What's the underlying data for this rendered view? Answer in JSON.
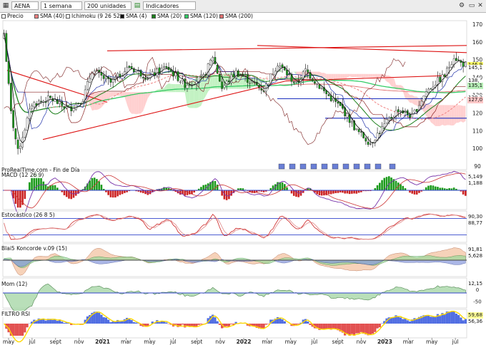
{
  "toolbar": {
    "symbol": "AENA",
    "interval": "1 semana",
    "bars": "200 unidades",
    "indicators": "Indicadores"
  },
  "legend": [
    {
      "label": "Precio",
      "color": "#ffffff"
    },
    {
      "label": "SMA (40)",
      "color": "#f08080"
    },
    {
      "label": "Ichimoku (9 26 52)",
      "color": "#ffffff"
    },
    {
      "label": "SMA (4)",
      "color": "#111111"
    },
    {
      "label": "SMA (20)",
      "color": "#1a7f1a"
    },
    {
      "label": "SMA (120)",
      "color": "#33cc66"
    },
    {
      "label": "SMA (200)",
      "color": "#e07070"
    }
  ],
  "source_label": "ProRealTime.com - Fin de Día",
  "chart_data": {
    "type": "candlestick",
    "x_ticks": [
      "may",
      "jul",
      "sept",
      "nov",
      "2021",
      "mar",
      "may",
      "jul",
      "sept",
      "nov",
      "2022",
      "mar",
      "may",
      "jul",
      "sept",
      "nov",
      "2023",
      "mar",
      "may",
      "jul"
    ],
    "y_ticks": [
      90,
      100,
      110,
      120,
      130,
      140,
      150,
      160,
      170
    ],
    "ylim": [
      88,
      172
    ],
    "grid": false,
    "price_anchors": [
      [
        0,
        165
      ],
      [
        3,
        120
      ],
      [
        6,
        98
      ],
      [
        12,
        125
      ],
      [
        20,
        128
      ],
      [
        28,
        122
      ],
      [
        34,
        128
      ],
      [
        38,
        144
      ],
      [
        46,
        137
      ],
      [
        54,
        146
      ],
      [
        62,
        140
      ],
      [
        70,
        146
      ],
      [
        78,
        136
      ],
      [
        86,
        140
      ],
      [
        90,
        152
      ],
      [
        94,
        134
      ],
      [
        100,
        143
      ],
      [
        106,
        138
      ],
      [
        112,
        133
      ],
      [
        118,
        148
      ],
      [
        126,
        136
      ],
      [
        130,
        144
      ],
      [
        138,
        132
      ],
      [
        146,
        122
      ],
      [
        152,
        110
      ],
      [
        158,
        103
      ],
      [
        164,
        113
      ],
      [
        170,
        122
      ],
      [
        176,
        118
      ],
      [
        182,
        132
      ],
      [
        186,
        137
      ],
      [
        190,
        141
      ],
      [
        194,
        152
      ],
      [
        197,
        148
      ],
      [
        200,
        147
      ]
    ],
    "price_labels": [
      {
        "text": "146,9",
        "bg": "#ffff66"
      },
      {
        "text": "145,1",
        "bg": "#ffffff"
      },
      {
        "text": "138,",
        "bg": "#ffffff"
      },
      {
        "text": "135,1",
        "bg": "#b8f0b8"
      },
      {
        "text": "128,3",
        "bg": "#ffffff"
      },
      {
        "text": "127,0",
        "bg": "#ffc8c8"
      }
    ],
    "panels": [
      {
        "name": "MACD (12 26 9)",
        "y_ticks": [],
        "labels": [
          {
            "text": "5,149",
            "bg": "#ffffff"
          },
          {
            "text": "1,188",
            "bg": "#ffffff"
          }
        ]
      },
      {
        "name": "Estocástico (26 8 5)",
        "y_ticks": [],
        "labels": [
          {
            "text": "90,30",
            "bg": "#ffffff"
          },
          {
            "text": "88,77",
            "bg": "#ffffff"
          }
        ]
      },
      {
        "name": "Blai5 Koncorde v.09 (15)",
        "y_ticks": [
          "0"
        ],
        "labels": [
          {
            "text": "91,81",
            "bg": "#ffffff"
          },
          {
            "text": "5,628",
            "bg": "#ffffff"
          }
        ]
      },
      {
        "name": "Mom (12)",
        "y_ticks": [
          "0",
          "-50"
        ],
        "labels": [
          {
            "text": "12,15",
            "bg": "#ffffff"
          }
        ]
      },
      {
        "name": "FILTRO RSI",
        "y_ticks": [
          "10"
        ],
        "labels": [
          {
            "text": "59,68",
            "bg": "#ffff99"
          },
          {
            "text": "56,36",
            "bg": "#ffffff"
          }
        ]
      }
    ]
  }
}
